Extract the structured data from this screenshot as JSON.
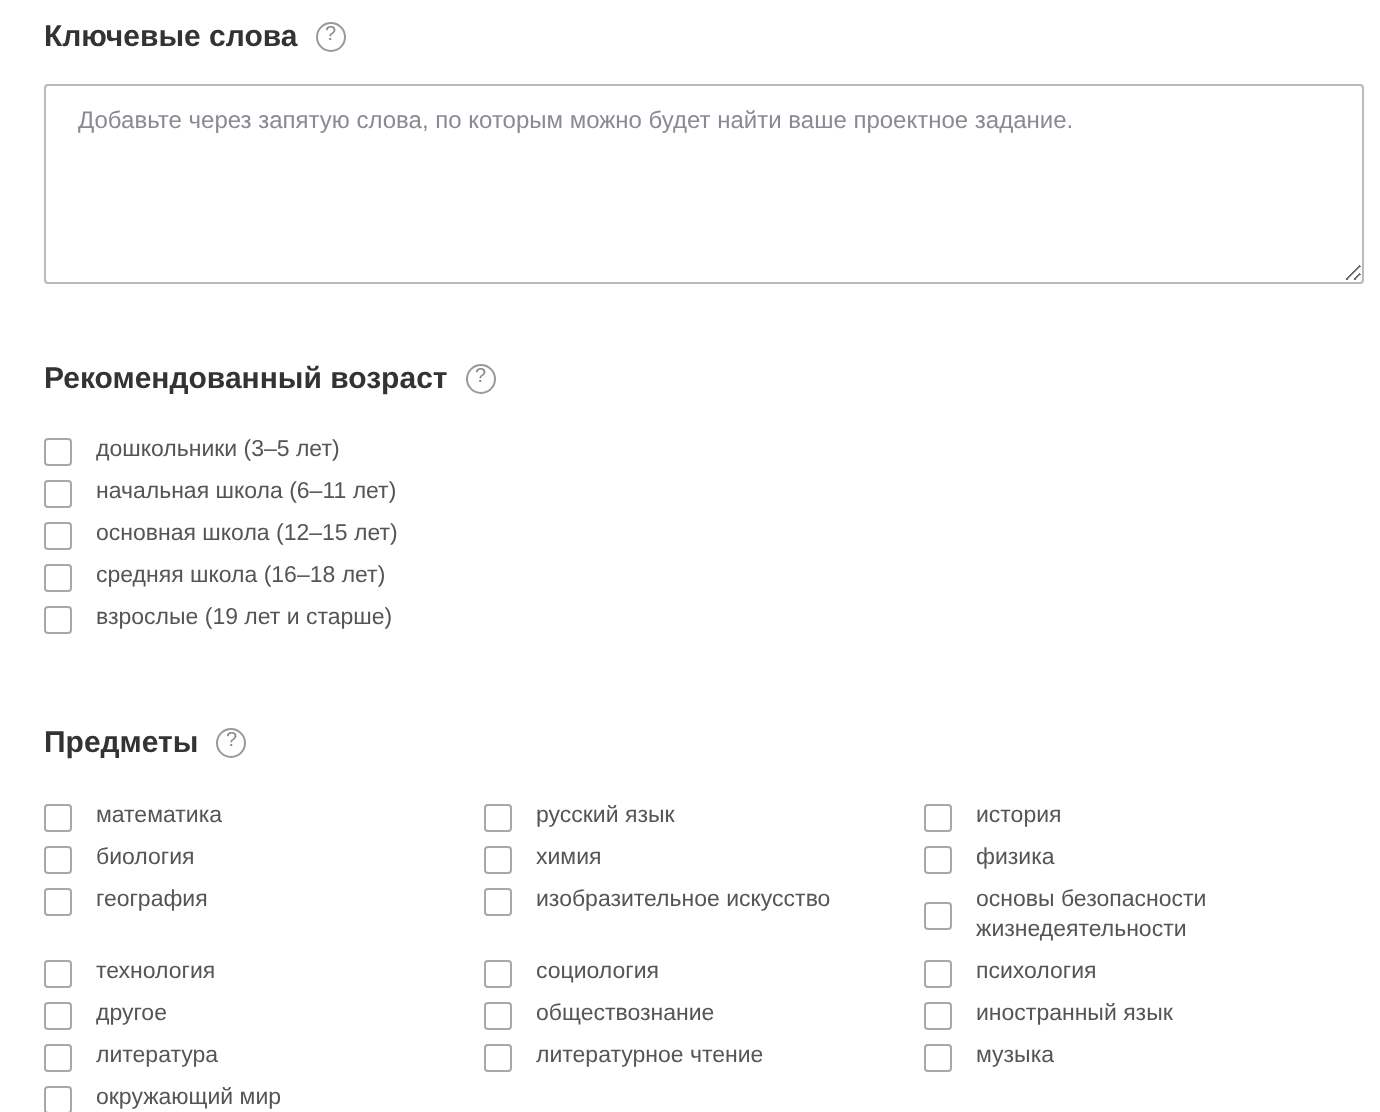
{
  "keywords": {
    "title": "Ключевые слова",
    "help": "?",
    "placeholder": "Добавьте через запятую слова, по которым можно будет найти ваше проектное задание."
  },
  "age": {
    "title": "Рекомендованный возраст",
    "help": "?",
    "options": [
      {
        "label": "дошкольники (3–5 лет)",
        "checked": false
      },
      {
        "label": "начальная школа (6–11 лет)",
        "checked": false
      },
      {
        "label": "основная школа (12–15 лет)",
        "checked": false
      },
      {
        "label": "средняя школа (16–18 лет)",
        "checked": false
      },
      {
        "label": "взрослые (19 лет и старше)",
        "checked": false
      }
    ]
  },
  "subjects": {
    "title": "Предметы",
    "help": "?",
    "options": [
      {
        "label": "математика",
        "checked": false
      },
      {
        "label": "русский язык",
        "checked": false
      },
      {
        "label": "история",
        "checked": false
      },
      {
        "label": "биология",
        "checked": false
      },
      {
        "label": "химия",
        "checked": false
      },
      {
        "label": "физика",
        "checked": false
      },
      {
        "label": "география",
        "checked": false
      },
      {
        "label": "изобразительное искусство",
        "checked": false
      },
      {
        "label": "основы безопасности жизнедеятельности",
        "checked": false
      },
      {
        "label": "технология",
        "checked": false
      },
      {
        "label": "социология",
        "checked": false
      },
      {
        "label": "психология",
        "checked": false
      },
      {
        "label": "другое",
        "checked": false
      },
      {
        "label": "обществознание",
        "checked": false
      },
      {
        "label": "иностранный язык",
        "checked": false
      },
      {
        "label": "литература",
        "checked": false
      },
      {
        "label": "литературное чтение",
        "checked": false
      },
      {
        "label": "музыка",
        "checked": false
      },
      {
        "label": "окружающий мир",
        "checked": false
      }
    ]
  }
}
